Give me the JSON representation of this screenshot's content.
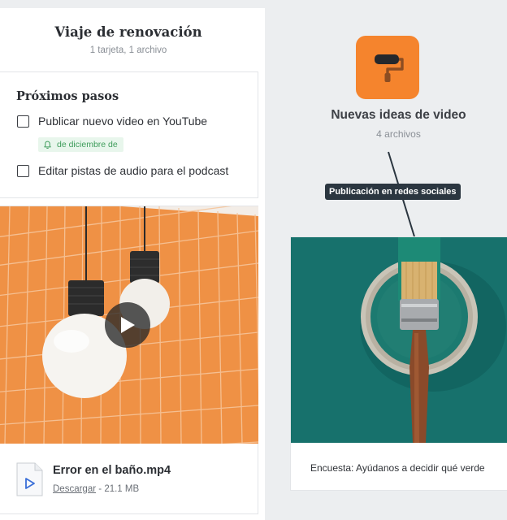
{
  "left_board": {
    "title": "Viaje de renovación",
    "subtitle": "1 tarjeta, 1 archivo",
    "tasks_card": {
      "title": "Próximos pasos",
      "tasks": [
        {
          "label": "Publicar nuevo video en YouTube",
          "checked": false
        },
        {
          "label": "Editar pistas de audio para el podcast",
          "checked": false
        }
      ],
      "reminder": "de diciembre de"
    },
    "video_card": {
      "file_name": "Error en el baño.mp4",
      "download_label": "Descargar",
      "separator": "-",
      "file_size": "21.1 MB"
    }
  },
  "right_board": {
    "title": "Nuevas ideas de video",
    "subtitle": "4 archivos",
    "tooltip": "Publicación en redes sociales",
    "poll_caption": "Encuesta: Ayúdanos a decidir qué verde"
  },
  "colors": {
    "accent_orange": "#f5842d",
    "reminder_green": "#3f9d5c",
    "tooltip_bg": "#2b3640",
    "play_button_blue": "#3a6fd8"
  }
}
